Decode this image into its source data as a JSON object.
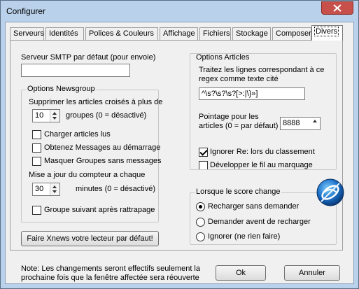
{
  "window": {
    "title": "Configurer"
  },
  "tabs": [
    "Serveurs",
    "Identités",
    "Polices & Couleurs",
    "Affichage",
    "Fichiers",
    "Stockage",
    "Composer",
    "Divers"
  ],
  "active_tab": "Divers",
  "smtp": {
    "label": "Serveur SMTP par défaut (pour envoie)",
    "value": ""
  },
  "newsgroup": {
    "legend": "Options Newsgroup",
    "crosspost_label": "Supprimer les articles croisés à plus de",
    "crosspost_value": "10",
    "crosspost_suffix": "groupes (0 = désactivé)",
    "checkboxes": [
      {
        "label": "Charger articles lus",
        "checked": false
      },
      {
        "label": "Obtenez Messages au démarrage",
        "checked": false
      },
      {
        "label": "Masquer Groupes sans messages",
        "checked": false
      }
    ],
    "counter_label": "Mise a jour du compteur a chaque",
    "counter_value": "30",
    "counter_suffix": "minutes (0 = désactivé)",
    "next_group": {
      "label": "Groupe suivant après rattrapage",
      "checked": false
    }
  },
  "articles": {
    "legend": "Options Articles",
    "quote_label": "Traitez les lignes correspondant à ce regex comme texte cité",
    "quote_value": "^\\s?\\s?\\s?[>:|\\}»]",
    "wrap_label": "Pointage pour les articles (0 = par défaut)",
    "wrap_value": "8888",
    "ignore_re": {
      "label": "Ignorer Re: lors du classement",
      "checked": true
    },
    "expand_thread": {
      "label": "Développer le fil au marquage",
      "checked": false
    }
  },
  "score": {
    "legend": "Lorsque le score change",
    "options": [
      {
        "label": "Recharger sans demander",
        "checked": true
      },
      {
        "label": "Demander avent de recharger",
        "checked": false
      },
      {
        "label": "Ignorer (ne rien faire)",
        "checked": false
      }
    ]
  },
  "default_reader_button": "Faire Xnews votre lecteur par défaut!",
  "note": "Note: Les changements seront effectifs seulement la prochaine fois que la fenêtre affectée sera réouverte",
  "ok_button": "Ok",
  "cancel_button": "Annuler"
}
